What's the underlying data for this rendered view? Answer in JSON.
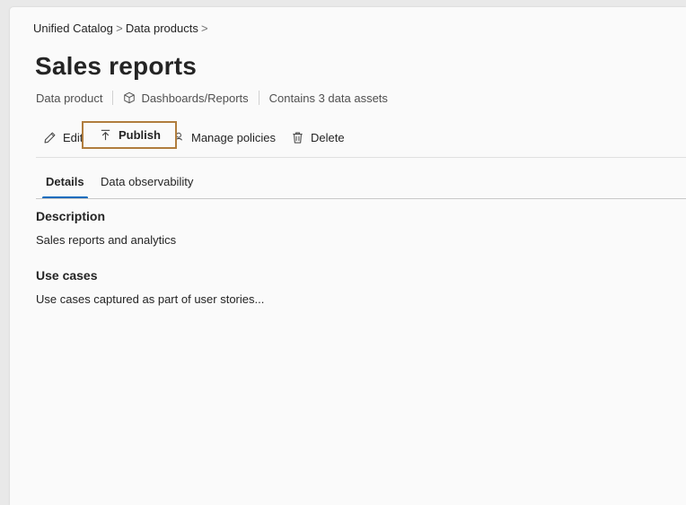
{
  "breadcrumb": {
    "items": [
      "Unified Catalog",
      "Data products"
    ],
    "separator": ">"
  },
  "page": {
    "title": "Sales reports"
  },
  "meta": {
    "type": "Data product",
    "category": "Dashboards/Reports",
    "assets": "Contains 3 data assets"
  },
  "toolbar": {
    "edit": "Edit",
    "publish": "Publish",
    "manage_policies": "Manage policies",
    "delete": "Delete"
  },
  "tabs": {
    "details": "Details",
    "observability": "Data observability"
  },
  "details": {
    "description_title": "Description",
    "description_text": "Sales reports and analytics",
    "use_cases_title": "Use cases",
    "use_cases_text": "Use cases captured as part of user stories..."
  },
  "colors": {
    "accent": "#0f6cbd",
    "highlight_border": "#b07d3e"
  }
}
